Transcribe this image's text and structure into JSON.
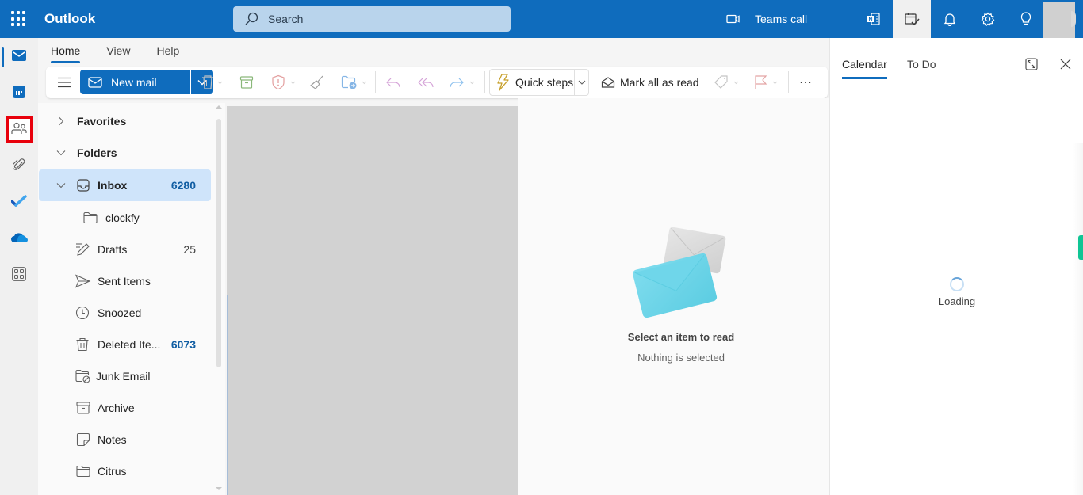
{
  "app": {
    "title": "Outlook"
  },
  "header": {
    "search_placeholder": "Search",
    "teams_call_label": "Teams call",
    "icons": [
      "app-launcher-icon",
      "search-icon",
      "video-camera-icon",
      "onenote-icon",
      "my-day-icon",
      "bell-icon",
      "gear-icon",
      "lightbulb-icon",
      "avatar"
    ]
  },
  "rail": {
    "items": [
      {
        "name": "mail",
        "icon": "mail-icon",
        "selected": true
      },
      {
        "name": "calendar",
        "icon": "calendar-icon",
        "highlighted": true
      },
      {
        "name": "people",
        "icon": "people-icon"
      },
      {
        "name": "files",
        "icon": "paperclip-icon"
      },
      {
        "name": "todo",
        "icon": "todo-check-icon"
      },
      {
        "name": "onedrive",
        "icon": "onedrive-cloud-icon"
      },
      {
        "name": "apps",
        "icon": "apps-grid-icon"
      }
    ]
  },
  "ribbon": {
    "tabs": [
      {
        "label": "Home",
        "active": true
      },
      {
        "label": "View"
      },
      {
        "label": "Help"
      }
    ],
    "new_mail_label": "New mail",
    "quick_steps_label": "Quick steps",
    "mark_all_read_label": "Mark all as read",
    "more_label": "⋯"
  },
  "folders": {
    "favorites_label": "Favorites",
    "folders_label": "Folders",
    "items": [
      {
        "label": "Inbox",
        "count": "6280",
        "count_style": "bold",
        "selected": true,
        "icon": "inbox-icon"
      },
      {
        "label": "clockfy",
        "count": "",
        "icon": "folder-icon"
      },
      {
        "label": "Drafts",
        "count": "25",
        "icon": "pencil-icon"
      },
      {
        "label": "Sent Items",
        "count": "",
        "icon": "send-icon"
      },
      {
        "label": "Snoozed",
        "count": "",
        "icon": "clock-icon"
      },
      {
        "label": "Deleted Ite...",
        "count": "6073",
        "count_style": "bold",
        "icon": "trash-icon"
      },
      {
        "label": "Junk Email",
        "count": "",
        "icon": "junk-folder-icon"
      },
      {
        "label": "Archive",
        "count": "",
        "icon": "archive-icon"
      },
      {
        "label": "Notes",
        "count": "",
        "icon": "note-icon"
      },
      {
        "label": "Citrus",
        "count": "",
        "icon": "folder-icon"
      }
    ]
  },
  "reading": {
    "title": "Select an item to read",
    "subtitle": "Nothing is selected"
  },
  "side_panel": {
    "tabs": [
      {
        "label": "Calendar",
        "active": true
      },
      {
        "label": "To Do"
      }
    ],
    "loading_label": "Loading"
  },
  "colors": {
    "brand": "#0f6cbd",
    "selection": "#cfe4fa",
    "highlight_box": "#e8000b",
    "count_blue": "#115ea3"
  }
}
